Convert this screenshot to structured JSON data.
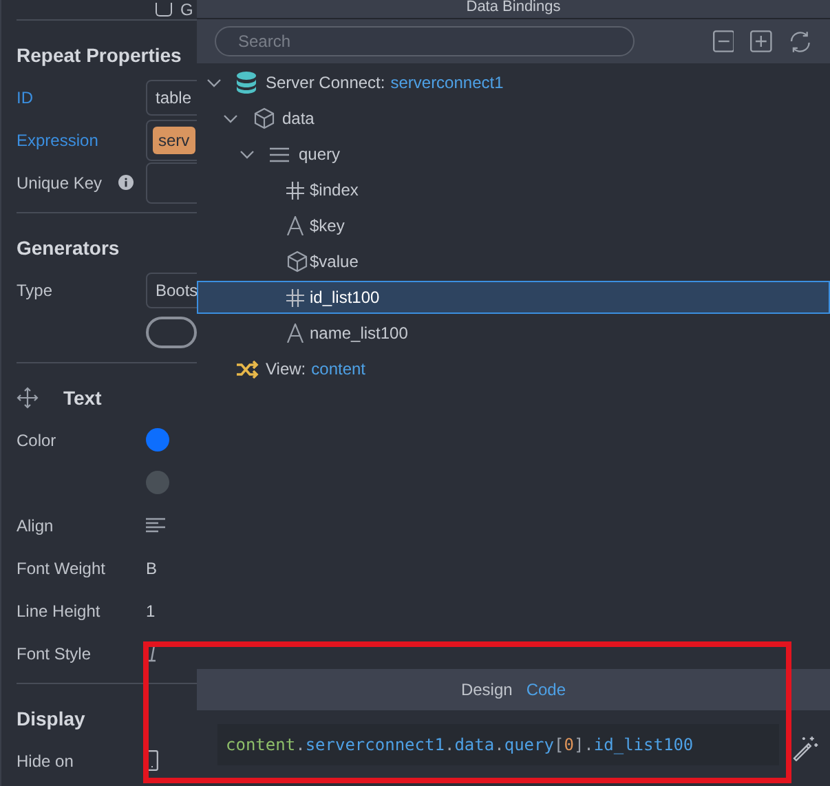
{
  "left_panel": {
    "top_checkbox": {
      "label": "G",
      "checked": false
    },
    "sections": [
      {
        "title": "Repeat Properties",
        "rows": [
          {
            "kind": "field",
            "label": "ID",
            "bound": true,
            "value": "table"
          },
          {
            "kind": "tag_field",
            "label": "Expression",
            "bound": true,
            "value": "serv"
          },
          {
            "kind": "info_field",
            "label": "Unique Key",
            "bound": false
          }
        ]
      },
      {
        "title": "Generators",
        "rows": [
          {
            "kind": "select",
            "label": "Type",
            "bound": false,
            "value": "Boots"
          },
          {
            "kind": "outline_button"
          }
        ]
      },
      {
        "title": "Text",
        "has_move_icon": true,
        "rows": [
          {
            "kind": "swatch",
            "label": "Color",
            "bound": false,
            "color": "#0d6efd"
          },
          {
            "kind": "swatch",
            "color": "#495057"
          },
          {
            "kind": "align_icon",
            "label": "Align",
            "bound": false
          },
          {
            "kind": "text_value",
            "label": "Font Weight",
            "bound": false,
            "value": "B"
          },
          {
            "kind": "text_value",
            "label": "Line Height",
            "bound": false,
            "value": "1"
          },
          {
            "kind": "italic_icon",
            "label": "Font Style",
            "bound": false
          }
        ]
      },
      {
        "title": "Display",
        "rows": [
          {
            "kind": "phone_icon",
            "label": "Hide on",
            "bound": false
          }
        ]
      }
    ]
  },
  "dialog": {
    "title": "Data Bindings",
    "search": {
      "placeholder": "Search"
    },
    "tree": [
      {
        "kind": "database",
        "label": "Server Connect:",
        "name": "serverconnect1",
        "expanded": true,
        "selected": false,
        "children": [
          {
            "kind": "object",
            "label": "data",
            "expanded": true,
            "selected": false,
            "children": [
              {
                "kind": "array",
                "label": "query",
                "expanded": true,
                "selected": false,
                "children": [
                  {
                    "kind": "number",
                    "label": "$index",
                    "selected": false
                  },
                  {
                    "kind": "string",
                    "label": "$key",
                    "selected": false
                  },
                  {
                    "kind": "object",
                    "label": "$value",
                    "selected": false
                  },
                  {
                    "kind": "number",
                    "label": "id_list100",
                    "selected": true
                  },
                  {
                    "kind": "string",
                    "label": "name_list100",
                    "selected": false
                  }
                ]
              }
            ]
          }
        ]
      },
      {
        "kind": "shuffle",
        "label": "View:",
        "name": "content",
        "selected": false
      }
    ],
    "mode_tabs": [
      {
        "label": "Design",
        "selected": false
      },
      {
        "label": "Code",
        "selected": true
      }
    ],
    "code": [
      {
        "kind": "root",
        "text": "content"
      },
      {
        "kind": "punct",
        "text": "."
      },
      {
        "kind": "path",
        "text": "serverconnect1"
      },
      {
        "kind": "punct",
        "text": "."
      },
      {
        "kind": "path",
        "text": "data"
      },
      {
        "kind": "punct",
        "text": "."
      },
      {
        "kind": "path",
        "text": "query"
      },
      {
        "kind": "punct",
        "text": "["
      },
      {
        "kind": "number",
        "text": "0"
      },
      {
        "kind": "punct",
        "text": "]."
      },
      {
        "kind": "path",
        "text": "id_list100"
      }
    ]
  }
}
